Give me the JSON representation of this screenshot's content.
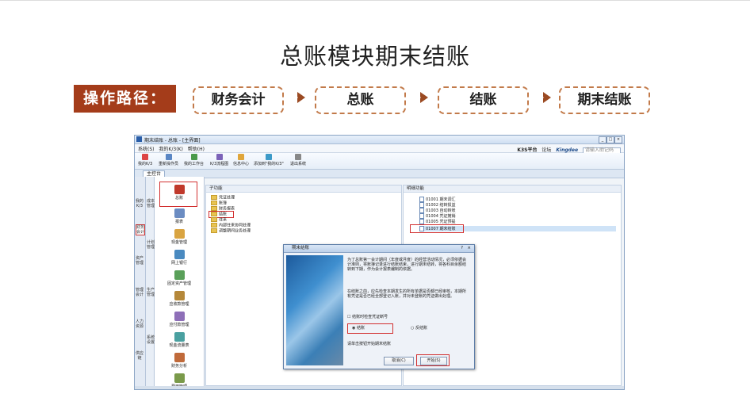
{
  "slide": {
    "title": "总账模块期末结账",
    "path_label": "操作路径：",
    "steps": [
      "财务会计",
      "总账",
      "结账",
      "期末结账"
    ]
  },
  "app": {
    "window_title": "期末结账 - 总账 - [主界面]",
    "menu": [
      "系统(S)",
      "我的K/3(K)",
      "帮助(H)"
    ],
    "header_right": {
      "platform": "K3S平台",
      "forum": "论坛",
      "brand": "Kingdee",
      "help_placeholder": "请输入助记码"
    },
    "toolbar": [
      "我的K/3",
      "重新操作员",
      "我的工作台",
      "K/3流程图",
      "信息中心",
      "添加到\"我的K/3\"",
      "退出系统"
    ],
    "tab": "主控台",
    "leftnav": [
      "我的K/3",
      "财务会计",
      "资产管理",
      "管理会计",
      "人力资源",
      "供应链",
      "成本管理",
      "计划管理",
      "生产管理",
      "系统设置"
    ],
    "modules": [
      "总账",
      "报表",
      "现金管理",
      "网上银行",
      "固定资产管理",
      "应收款管理",
      "应付款管理",
      "现金流量表",
      "财务分析",
      "费用管理"
    ],
    "subfunc_header": "子功能",
    "subfunctions": [
      "凭证处理",
      "账簿",
      "财务报表",
      "结账",
      "往来",
      "内部往来协同处理",
      "调整期间业务处理"
    ],
    "detail_header": "明细功能",
    "details": [
      {
        "code": "01001",
        "name": "期末调汇"
      },
      {
        "code": "01002",
        "name": "结转损益"
      },
      {
        "code": "01003",
        "name": "自动转账"
      },
      {
        "code": "01004",
        "name": "凭证摊销"
      },
      {
        "code": "01005",
        "name": "凭证预提"
      },
      {
        "code": "01007",
        "name": "期末结账"
      }
    ]
  },
  "dialog": {
    "title": "期末结账",
    "para1": "为了总账第一会计期间（年度或月度）的经营活动情况，必须依据会计准则，将账簿记录进行结账结束，进行期末结转，将各科目余额结转到下期，作为会计报表编制的依据。",
    "para2": "在结账之前，应先检查本期发生的所有单据是否都已经审核，本期所有凭证是否已经全部登记入账，并对未登账的凭证做出处理。",
    "checkbox_label": "结账时检查凭证断号",
    "radio_close": "结账",
    "radio_reverse": "反结账",
    "hint": "请单击按钮开始期末结账",
    "cancel": "取消(C)",
    "start": "开始(S)"
  }
}
